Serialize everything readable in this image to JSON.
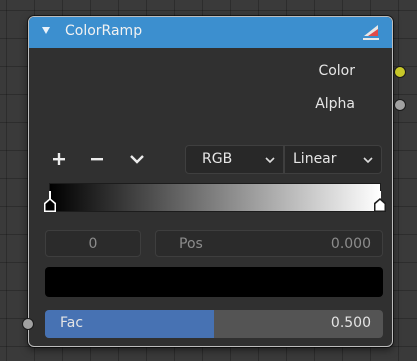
{
  "node": {
    "title": "ColorRamp",
    "outputs": [
      {
        "label": "Color",
        "socket_color": "#c7c729"
      },
      {
        "label": "Alpha",
        "socket_color": "#a1a1a1"
      }
    ]
  },
  "toolbar": {
    "add_icon": "plus-icon",
    "remove_icon": "minus-icon",
    "menu_icon": "chevron-down-icon",
    "color_mode": "RGB",
    "interpolation": "Linear"
  },
  "ramp": {
    "gradient_start": "#000000",
    "gradient_end": "#ffffff",
    "stops": [
      {
        "position": 0.0,
        "color": "#000000",
        "active": true
      },
      {
        "position": 1.0,
        "color": "#ffffff",
        "active": false
      }
    ]
  },
  "active_stop": {
    "index": "0",
    "pos_label": "Pos",
    "pos_value": "0.000",
    "color": "#000000"
  },
  "fac": {
    "label": "Fac",
    "value": "0.500",
    "fraction": 0.5,
    "fill_color": "#4772b3",
    "socket_color": "#a1a1a1"
  },
  "colors": {
    "header": "#3c8fcf",
    "node_bg": "#303030"
  }
}
